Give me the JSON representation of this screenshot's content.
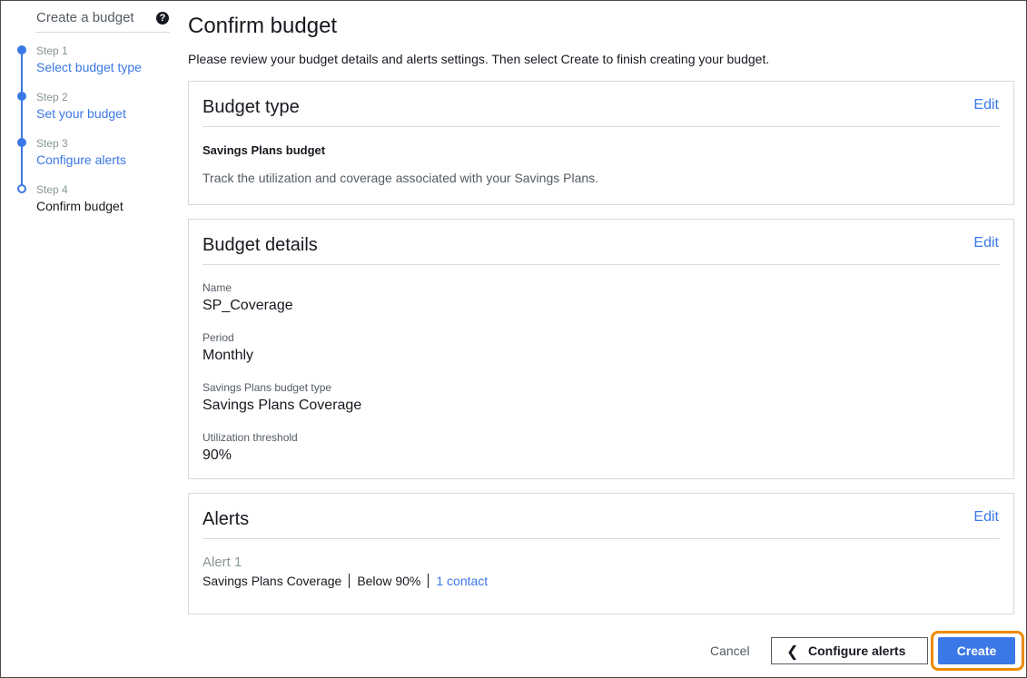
{
  "sidebar": {
    "title": "Create a budget",
    "help_icon": "?",
    "steps": [
      {
        "number": "Step 1",
        "label": "Select budget type"
      },
      {
        "number": "Step 2",
        "label": "Set your budget"
      },
      {
        "number": "Step 3",
        "label": "Configure alerts"
      },
      {
        "number": "Step 4",
        "label": "Confirm budget"
      }
    ]
  },
  "main": {
    "title": "Confirm budget",
    "description": "Please review your budget details and alerts settings. Then select Create to finish creating your budget.",
    "budget_type": {
      "title": "Budget type",
      "edit": "Edit",
      "name": "Savings Plans budget",
      "description": "Track the utilization and coverage associated with your Savings Plans."
    },
    "budget_details": {
      "title": "Budget details",
      "edit": "Edit",
      "fields": [
        {
          "label": "Name",
          "value": "SP_Coverage"
        },
        {
          "label": "Period",
          "value": "Monthly"
        },
        {
          "label": "Savings Plans budget type",
          "value": "Savings Plans Coverage"
        },
        {
          "label": "Utilization threshold",
          "value": "90%"
        }
      ]
    },
    "alerts": {
      "title": "Alerts",
      "edit": "Edit",
      "items": [
        {
          "title": "Alert 1",
          "type": "Savings Plans Coverage",
          "condition": "Below 90%",
          "contacts": "1 contact"
        }
      ]
    }
  },
  "footer": {
    "cancel": "Cancel",
    "back": "Configure alerts",
    "back_icon": "❮",
    "create": "Create"
  },
  "colors": {
    "accent": "#3b78e7",
    "focus_ring": "#ec8b00",
    "text": "#16191f",
    "muted": "#545b64"
  }
}
